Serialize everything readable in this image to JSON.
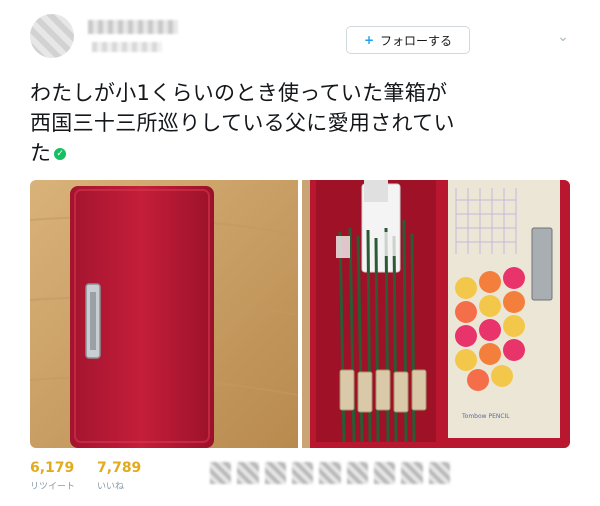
{
  "header": {
    "follow_label": "フォローする"
  },
  "tweet": {
    "text_lines": [
      "わたしが小1くらいのとき使っていた筆箱が",
      "西国三十三所巡りしている父に愛用されてい",
      "た"
    ],
    "photos": [
      {
        "alt": "pencil-case-closed"
      },
      {
        "alt": "pencil-case-open"
      }
    ],
    "case_label": "Tombow PENCIL"
  },
  "stats": {
    "retweets_count": "6,179",
    "retweets_label": "リツイート",
    "likes_count": "7,789",
    "likes_label": "いいね"
  },
  "colors": {
    "stat_accent": "#e2ab1b",
    "verified": "#17bf63",
    "case_red": "#c41e3a"
  }
}
